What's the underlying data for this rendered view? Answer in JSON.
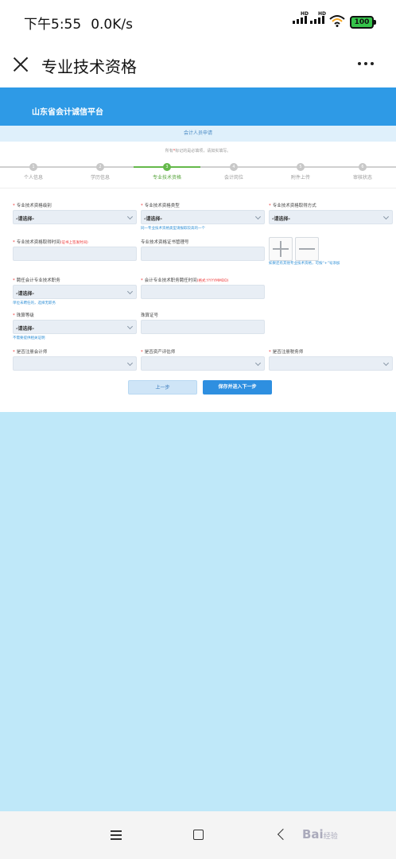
{
  "status": {
    "time": "下午5:55",
    "speed": "0.0K/s",
    "battery": "100"
  },
  "nav": {
    "title": "专业技术资格"
  },
  "platform": {
    "title": "山东省会计诚信平台"
  },
  "apply": {
    "title": "会计人员申请",
    "notice_prefix": "所有",
    "notice_star": "*",
    "notice_suffix": "标记的是必填项，请如实填写。"
  },
  "steps": [
    {
      "num": "1",
      "label": "个人信息"
    },
    {
      "num": "2",
      "label": "学历信息"
    },
    {
      "num": "3",
      "label": "专业技术资格"
    },
    {
      "num": "4",
      "label": "会计岗位"
    },
    {
      "num": "5",
      "label": "附件上传"
    },
    {
      "num": "6",
      "label": "审核状态"
    }
  ],
  "form": {
    "level_label": "专业技术资格级别",
    "level_value": "-请选择-",
    "type_label": "专业技术资格类型",
    "type_value": "-请选择-",
    "type_hint": "同一专业技术资格类型请报取较高的一个",
    "method_label": "专业技术资格取得方式",
    "method_value": "-请选择-",
    "time_label": "专业技术资格取得时间",
    "time_note": "(证书上签发时间)",
    "cert_label": "专业技术资格证书管理号",
    "add_hint": "如果还有其他专业技术资格，可按“+”号添加",
    "post_label": "聘任会计专业技术职务",
    "post_value": "-请选择-",
    "post_hint": "单位未聘任的，选择无职务",
    "post_time_label": "会计专业技术职务聘任时间",
    "post_time_note": "(格式:YYYYMMDD)",
    "rank_label": "珠算等级",
    "rank_value": "-请选择-",
    "rank_hint": "不需要提供相关证明",
    "abacus_label": "珠算证号",
    "cpa_label": "是否注册会计师",
    "appraiser_label": "是否资产评估师",
    "tax_label": "是否注册税务师"
  },
  "buttons": {
    "prev": "上一步",
    "next": "保存并进入下一步"
  },
  "watermark": {
    "text": "Bai",
    "sub": "经验"
  }
}
